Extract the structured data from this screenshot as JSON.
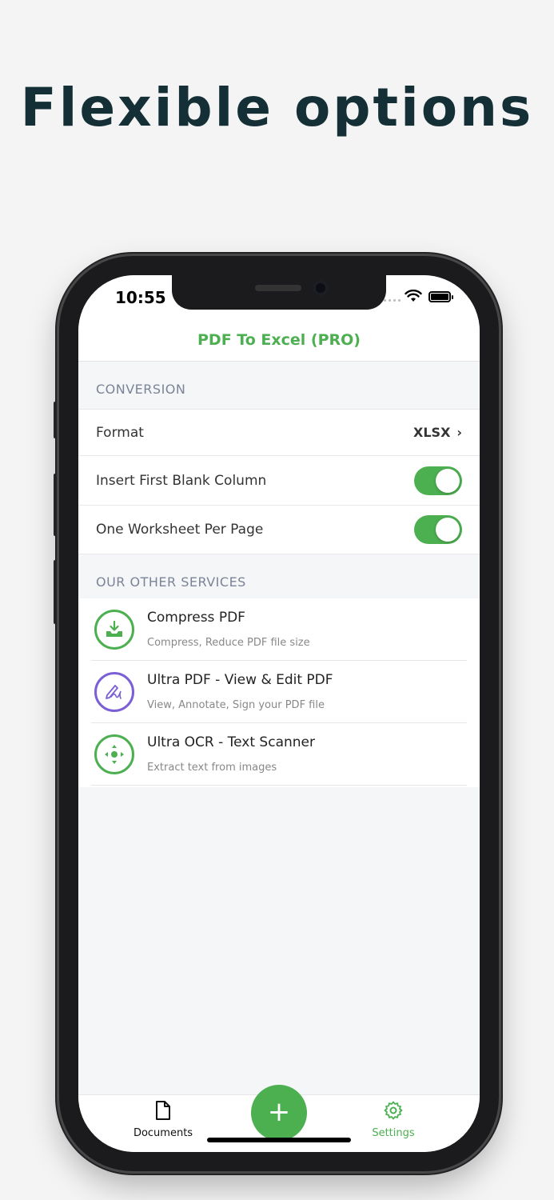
{
  "headline": "Flexible options",
  "status_bar": {
    "time": "10:55"
  },
  "nav": {
    "title": "PDF To Excel (PRO)"
  },
  "conversion": {
    "header": "CONVERSION",
    "format_label": "Format",
    "format_value": "XLSX",
    "blank_column_label": "Insert First Blank Column",
    "blank_column_on": true,
    "worksheet_label": "One Worksheet Per Page",
    "worksheet_on": true
  },
  "services": {
    "header": "OUR OTHER SERVICES",
    "items": [
      {
        "name": "Compress PDF",
        "description": "Compress, Reduce PDF file size",
        "icon": "compress-download-icon"
      },
      {
        "name": "Ultra PDF - View & Edit PDF",
        "description": "View, Annotate, Sign your PDF file",
        "icon": "signature-pen-icon"
      },
      {
        "name": "Ultra OCR - Text Scanner",
        "description": "Extract text from images",
        "icon": "scan-arrows-icon"
      }
    ]
  },
  "tabbar": {
    "documents_label": "Documents",
    "settings_label": "Settings",
    "fab_label": "+"
  },
  "colors": {
    "accent": "#4caf50",
    "headline": "#143036",
    "purple": "#7a5fd6",
    "section_text": "#7b8397"
  }
}
